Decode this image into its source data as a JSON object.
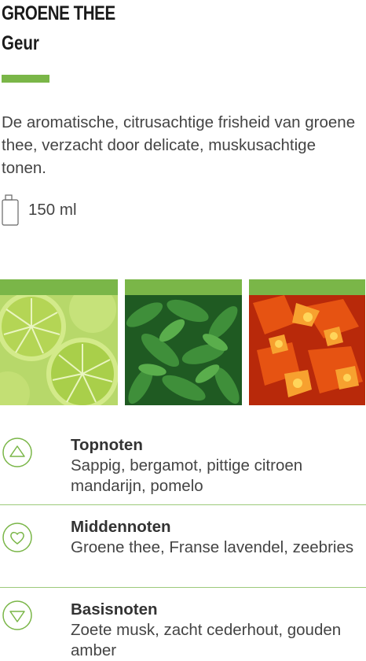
{
  "header": {
    "title": "GROENE THEE",
    "subtitle": "Geur",
    "accent_color": "#7ab648"
  },
  "description": "De aromatische, citrusachtige frisheid van groene thee, verzacht door delicate, muskusachtige tonen.",
  "volume": {
    "icon": "bottle-icon",
    "text": "150 ml"
  },
  "images": [
    {
      "name": "lime-slices",
      "icon": "lime-photo"
    },
    {
      "name": "green-tea-leaves",
      "icon": "tea-leaves-photo"
    },
    {
      "name": "amber-resin",
      "icon": "amber-photo"
    }
  ],
  "notes": [
    {
      "icon": "triangle-up-icon",
      "title": "Topnoten",
      "text": "Sappig, bergamot, pittige citroen mandarijn, pomelo"
    },
    {
      "icon": "heart-icon",
      "title": "Middennoten",
      "text": "Groene thee, Franse lavendel, zeebries"
    },
    {
      "icon": "triangle-down-icon",
      "title": "Basisnoten",
      "text": "Zoete musk, zacht cederhout, gouden amber"
    }
  ]
}
